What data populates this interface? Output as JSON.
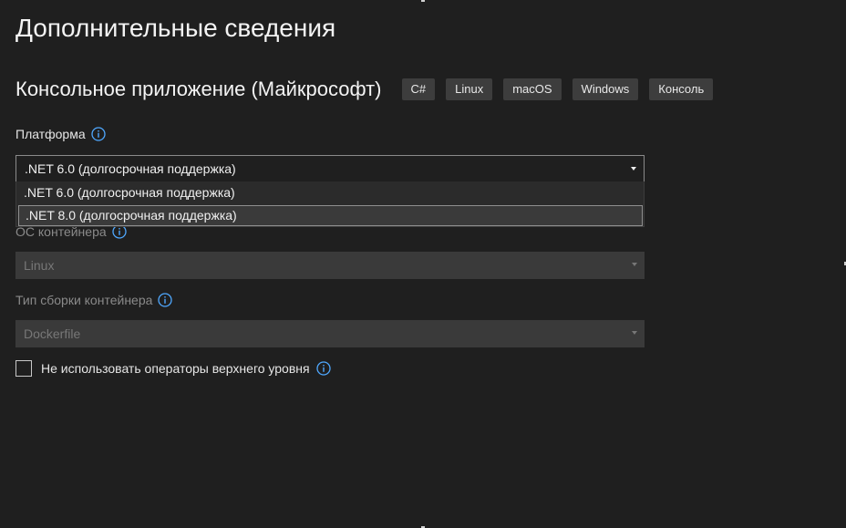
{
  "page": {
    "title": "Дополнительные сведения"
  },
  "template": {
    "name": "Консольное приложение (Майкрософт)",
    "tags": [
      "C#",
      "Linux",
      "macOS",
      "Windows",
      "Консоль"
    ]
  },
  "framework": {
    "label": "Платформа",
    "selected": ".NET 6.0 (долгосрочная поддержка)",
    "options": [
      ".NET 6.0 (долгосрочная поддержка)",
      ".NET 8.0 (долгосрочная поддержка)"
    ],
    "hovered_option": ".NET 8.0 (долгосрочная поддержка)"
  },
  "container_os": {
    "label": "ОС контейнера",
    "value": "Linux",
    "enabled": false
  },
  "container_build_type": {
    "label": "Тип сборки контейнера",
    "value": "Dockerfile",
    "enabled": false
  },
  "top_level_statements": {
    "label": "Не использовать операторы верхнего уровня",
    "checked": false
  },
  "colors": {
    "background": "#1f1f1f",
    "tag_background": "#3d3d3d",
    "info_icon": "#4fa8ff",
    "disabled_field": "#3a3a3a"
  },
  "icons": {
    "info": "info-circle-icon",
    "dropdown": "chevron-down-icon"
  }
}
